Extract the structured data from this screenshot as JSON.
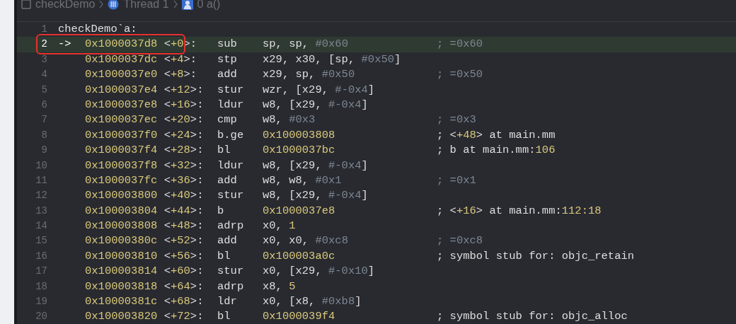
{
  "breadcrumb": [
    {
      "kind": "file",
      "label": "checkDemo"
    },
    {
      "kind": "thread",
      "label": "Thread 1"
    },
    {
      "kind": "frame",
      "label": "0 a()"
    }
  ],
  "rows": [
    {
      "line": "1",
      "label": "checkDemo`a:",
      "selected": false,
      "annotated": false
    },
    {
      "line": "2",
      "pc_arrow": "->",
      "address": "0x1000037d8",
      "offset": [
        {
          "text": "<"
        },
        {
          "text": "+0",
          "kind": "num"
        },
        {
          "text": ">:"
        }
      ],
      "mnemonic": "sub",
      "operands": [
        {
          "text": "sp, sp, "
        },
        {
          "text": "#0x60",
          "kind": "dim"
        }
      ],
      "comment": [
        {
          "text": "; =0x60",
          "kind": "dim"
        }
      ],
      "selected": true,
      "annotated": true
    },
    {
      "line": "3",
      "address": "0x1000037dc",
      "offset": [
        {
          "text": "<"
        },
        {
          "text": "+4",
          "kind": "num"
        },
        {
          "text": ">:"
        }
      ],
      "mnemonic": "stp",
      "operands": [
        {
          "text": "x29, x30, [sp, "
        },
        {
          "text": "#0x50",
          "kind": "dim"
        },
        {
          "text": "]"
        }
      ],
      "selected": false,
      "annotated": false
    },
    {
      "line": "4",
      "address": "0x1000037e0",
      "offset": [
        {
          "text": "<"
        },
        {
          "text": "+8",
          "kind": "num"
        },
        {
          "text": ">:"
        }
      ],
      "mnemonic": "add",
      "operands": [
        {
          "text": "x29, sp, "
        },
        {
          "text": "#0x50",
          "kind": "dim"
        }
      ],
      "comment": [
        {
          "text": "; =0x50",
          "kind": "dim"
        }
      ],
      "selected": false,
      "annotated": false
    },
    {
      "line": "5",
      "address": "0x1000037e4",
      "offset": [
        {
          "text": "<"
        },
        {
          "text": "+12",
          "kind": "num"
        },
        {
          "text": ">:"
        }
      ],
      "mnemonic": "stur",
      "operands": [
        {
          "text": "wzr, [x29, "
        },
        {
          "text": "#-0x4",
          "kind": "dim"
        },
        {
          "text": "]"
        }
      ],
      "selected": false,
      "annotated": false
    },
    {
      "line": "6",
      "address": "0x1000037e8",
      "offset": [
        {
          "text": "<"
        },
        {
          "text": "+16",
          "kind": "num"
        },
        {
          "text": ">:"
        }
      ],
      "mnemonic": "ldur",
      "operands": [
        {
          "text": "w8, [x29, "
        },
        {
          "text": "#-0x4",
          "kind": "dim"
        },
        {
          "text": "]"
        }
      ],
      "selected": false,
      "annotated": false
    },
    {
      "line": "7",
      "address": "0x1000037ec",
      "offset": [
        {
          "text": "<"
        },
        {
          "text": "+20",
          "kind": "num"
        },
        {
          "text": ">:"
        }
      ],
      "mnemonic": "cmp",
      "operands": [
        {
          "text": "w8, "
        },
        {
          "text": "#0x3",
          "kind": "dim"
        }
      ],
      "comment": [
        {
          "text": "; =0x3",
          "kind": "dim"
        }
      ],
      "selected": false,
      "annotated": false
    },
    {
      "line": "8",
      "address": "0x1000037f0",
      "offset": [
        {
          "text": "<"
        },
        {
          "text": "+24",
          "kind": "num"
        },
        {
          "text": ">:"
        }
      ],
      "mnemonic": "b.ge",
      "operands": [
        {
          "text": "0x100003808",
          "kind": "num"
        }
      ],
      "comment": [
        {
          "text": "; <"
        },
        {
          "text": "+48",
          "kind": "num"
        },
        {
          "text": "> at main.mm"
        }
      ],
      "selected": false,
      "annotated": false
    },
    {
      "line": "9",
      "address": "0x1000037f4",
      "offset": [
        {
          "text": "<"
        },
        {
          "text": "+28",
          "kind": "num"
        },
        {
          "text": ">:"
        }
      ],
      "mnemonic": "bl",
      "operands": [
        {
          "text": "0x1000037bc",
          "kind": "num"
        }
      ],
      "comment": [
        {
          "text": "; b at main.mm:"
        },
        {
          "text": "106",
          "kind": "num"
        }
      ],
      "selected": false,
      "annotated": false
    },
    {
      "line": "10",
      "address": "0x1000037f8",
      "offset": [
        {
          "text": "<"
        },
        {
          "text": "+32",
          "kind": "num"
        },
        {
          "text": ">:"
        }
      ],
      "mnemonic": "ldur",
      "operands": [
        {
          "text": "w8, [x29, "
        },
        {
          "text": "#-0x4",
          "kind": "dim"
        },
        {
          "text": "]"
        }
      ],
      "selected": false,
      "annotated": false
    },
    {
      "line": "11",
      "address": "0x1000037fc",
      "offset": [
        {
          "text": "<"
        },
        {
          "text": "+36",
          "kind": "num"
        },
        {
          "text": ">:"
        }
      ],
      "mnemonic": "add",
      "operands": [
        {
          "text": "w8, w8, "
        },
        {
          "text": "#0x1",
          "kind": "dim"
        }
      ],
      "comment": [
        {
          "text": "; =0x1",
          "kind": "dim"
        }
      ],
      "selected": false,
      "annotated": false
    },
    {
      "line": "12",
      "address": "0x100003800",
      "offset": [
        {
          "text": "<"
        },
        {
          "text": "+40",
          "kind": "num"
        },
        {
          "text": ">:"
        }
      ],
      "mnemonic": "stur",
      "operands": [
        {
          "text": "w8, [x29, "
        },
        {
          "text": "#-0x4",
          "kind": "dim"
        },
        {
          "text": "]"
        }
      ],
      "selected": false,
      "annotated": false
    },
    {
      "line": "13",
      "address": "0x100003804",
      "offset": [
        {
          "text": "<"
        },
        {
          "text": "+44",
          "kind": "num"
        },
        {
          "text": ">:"
        }
      ],
      "mnemonic": "b",
      "operands": [
        {
          "text": "0x1000037e8",
          "kind": "num"
        }
      ],
      "comment": [
        {
          "text": "; <"
        },
        {
          "text": "+16",
          "kind": "num"
        },
        {
          "text": "> at main.mm:"
        },
        {
          "text": "112:18",
          "kind": "num"
        }
      ],
      "selected": false,
      "annotated": false
    },
    {
      "line": "14",
      "address": "0x100003808",
      "offset": [
        {
          "text": "<"
        },
        {
          "text": "+48",
          "kind": "num"
        },
        {
          "text": ">:"
        }
      ],
      "mnemonic": "adrp",
      "operands": [
        {
          "text": "x0, "
        },
        {
          "text": "1",
          "kind": "num"
        }
      ],
      "selected": false,
      "annotated": false
    },
    {
      "line": "15",
      "address": "0x10000380c",
      "offset": [
        {
          "text": "<"
        },
        {
          "text": "+52",
          "kind": "num"
        },
        {
          "text": ">:"
        }
      ],
      "mnemonic": "add",
      "operands": [
        {
          "text": "x0, x0, "
        },
        {
          "text": "#0xc8",
          "kind": "dim"
        }
      ],
      "comment": [
        {
          "text": "; =0xc8",
          "kind": "dim"
        }
      ],
      "selected": false,
      "annotated": false
    },
    {
      "line": "16",
      "address": "0x100003810",
      "offset": [
        {
          "text": "<"
        },
        {
          "text": "+56",
          "kind": "num"
        },
        {
          "text": ">:"
        }
      ],
      "mnemonic": "bl",
      "operands": [
        {
          "text": "0x100003a0c",
          "kind": "num"
        }
      ],
      "comment": [
        {
          "text": "; symbol stub for: objc_retain"
        }
      ],
      "selected": false,
      "annotated": false
    },
    {
      "line": "17",
      "address": "0x100003814",
      "offset": [
        {
          "text": "<"
        },
        {
          "text": "+60",
          "kind": "num"
        },
        {
          "text": ">:"
        }
      ],
      "mnemonic": "stur",
      "operands": [
        {
          "text": "x0, [x29, "
        },
        {
          "text": "#-0x10",
          "kind": "dim"
        },
        {
          "text": "]"
        }
      ],
      "selected": false,
      "annotated": false
    },
    {
      "line": "18",
      "address": "0x100003818",
      "offset": [
        {
          "text": "<"
        },
        {
          "text": "+64",
          "kind": "num"
        },
        {
          "text": ">:"
        }
      ],
      "mnemonic": "adrp",
      "operands": [
        {
          "text": "x8, "
        },
        {
          "text": "5",
          "kind": "num"
        }
      ],
      "selected": false,
      "annotated": false
    },
    {
      "line": "19",
      "address": "0x10000381c",
      "offset": [
        {
          "text": "<"
        },
        {
          "text": "+68",
          "kind": "num"
        },
        {
          "text": ">:"
        }
      ],
      "mnemonic": "ldr",
      "operands": [
        {
          "text": "x0, [x8, "
        },
        {
          "text": "#0xb8",
          "kind": "dim"
        },
        {
          "text": "]"
        }
      ],
      "selected": false,
      "annotated": false
    },
    {
      "line": "20",
      "address": "0x100003820",
      "offset": [
        {
          "text": "<"
        },
        {
          "text": "+72",
          "kind": "num"
        },
        {
          "text": ">:"
        }
      ],
      "mnemonic": "bl",
      "operands": [
        {
          "text": "0x1000039f4",
          "kind": "num"
        }
      ],
      "comment": [
        {
          "text": "; symbol stub for: objc_alloc"
        }
      ],
      "selected": false,
      "annotated": false
    }
  ]
}
